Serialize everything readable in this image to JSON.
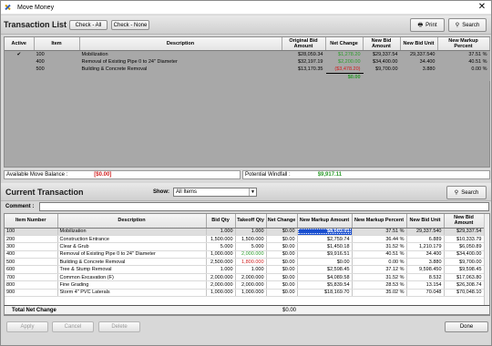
{
  "window": {
    "title": "Move Money"
  },
  "transaction_list": {
    "title": "Transaction List",
    "check_all_label": "Check - All",
    "check_none_label": "Check - None",
    "print_label": "Print",
    "search_label": "Search",
    "columns": [
      "Active",
      "Item",
      "Description",
      "Original Bid Amount",
      "Net Change",
      "New Bid Amount",
      "New Bid Unit",
      "New Markup Percent"
    ],
    "rows": [
      {
        "active": "✔",
        "item": "100",
        "description": "Mobilization",
        "original": "$28,059.34",
        "net": "$1,278.20",
        "net_color": "green",
        "new_amount": "$29,337.54",
        "new_unit": "29,337.540",
        "markup": "37.51 %"
      },
      {
        "active": "",
        "item": "400",
        "description": "Removal of Existing Pipe 0 to 24\" Diameter",
        "original": "$32,197.19",
        "net": "$2,200.00",
        "net_color": "green",
        "new_amount": "$34,400.00",
        "new_unit": "34.400",
        "markup": "40.51 %"
      },
      {
        "active": "",
        "item": "500",
        "description": "Building & Concrete Removal",
        "original": "$13,170.35",
        "net": "($3,478.20)",
        "net_color": "red",
        "new_amount": "$9,700.00",
        "new_unit": "3.880",
        "markup": "0.00 %"
      }
    ],
    "net_total": "$0.00",
    "available_label": "Available Move Balance :",
    "available_value": "[$0.00]",
    "windfall_label": "Potential Windfall :",
    "windfall_value": "$9,917.11"
  },
  "current_transaction": {
    "title": "Current Transaction",
    "show_label": "Show:",
    "show_value": "All Items",
    "search_label": "Search",
    "comment_label": "Comment :",
    "comment_value": "",
    "columns": [
      "Item Number",
      "Description",
      "Bid Qty",
      "Takeoff Qty",
      "Net Change",
      "New Markup Amount",
      "New Markup Percent",
      "New Bid Unit",
      "New Bid Amount"
    ],
    "rows": [
      {
        "item": "100",
        "description": "Mobilization",
        "bid_qty": "1.000",
        "takeoff_qty": "1.000",
        "takeoff_color": "",
        "net": "$0.00",
        "markup_amt": "$8,003.01",
        "markup_pct": "37.51 %",
        "bid_unit": "29,337.540",
        "bid_amt": "$29,337.54",
        "selected": true
      },
      {
        "item": "200",
        "description": "Construction Entrance",
        "bid_qty": "1,500.000",
        "takeoff_qty": "1,500.000",
        "takeoff_color": "",
        "net": "$0.00",
        "markup_amt": "$2,759.74",
        "markup_pct": "36.44 %",
        "bid_unit": "6.889",
        "bid_amt": "$10,333.79",
        "selected": false
      },
      {
        "item": "300",
        "description": "Clear & Grub",
        "bid_qty": "5.000",
        "takeoff_qty": "5.000",
        "takeoff_color": "",
        "net": "$0.00",
        "markup_amt": "$1,450.18",
        "markup_pct": "31.52 %",
        "bid_unit": "1,210.179",
        "bid_amt": "$6,050.89",
        "selected": false
      },
      {
        "item": "400",
        "description": "Removal of Existing Pipe 0 to 24\" Diameter",
        "bid_qty": "1,000.000",
        "takeoff_qty": "2,000.000",
        "takeoff_color": "green",
        "net": "$0.00",
        "markup_amt": "$9,916.51",
        "markup_pct": "40.51 %",
        "bid_unit": "34.400",
        "bid_amt": "$34,400.00",
        "selected": false
      },
      {
        "item": "500",
        "description": "Building & Concrete Removal",
        "bid_qty": "2,500.000",
        "takeoff_qty": "1,800.000",
        "takeoff_color": "red",
        "net": "$0.00",
        "markup_amt": "$0.00",
        "markup_pct": "0.00 %",
        "bid_unit": "3.880",
        "bid_amt": "$9,700.00",
        "selected": false
      },
      {
        "item": "600",
        "description": "Tree & Stump Removal",
        "bid_qty": "1.000",
        "takeoff_qty": "1.000",
        "takeoff_color": "",
        "net": "$0.00",
        "markup_amt": "$2,598.45",
        "markup_pct": "37.12 %",
        "bid_unit": "9,598.450",
        "bid_amt": "$9,598.45",
        "selected": false
      },
      {
        "item": "700",
        "description": "Common Excavation (F)",
        "bid_qty": "2,000.000",
        "takeoff_qty": "2,000.000",
        "takeoff_color": "",
        "net": "$0.00",
        "markup_amt": "$4,089.58",
        "markup_pct": "31.52 %",
        "bid_unit": "8.532",
        "bid_amt": "$17,063.80",
        "selected": false
      },
      {
        "item": "800",
        "description": "Fine Grading",
        "bid_qty": "2,000.000",
        "takeoff_qty": "2,000.000",
        "takeoff_color": "",
        "net": "$0.00",
        "markup_amt": "$5,839.54",
        "markup_pct": "28.53 %",
        "bid_unit": "13.154",
        "bid_amt": "$26,308.74",
        "selected": false
      },
      {
        "item": "900",
        "description": "Storm 4\" PVC Laterals",
        "bid_qty": "1,000.000",
        "takeoff_qty": "1,000.000",
        "takeoff_color": "",
        "net": "$0.00",
        "markup_amt": "$18,169.70",
        "markup_pct": "35.02 %",
        "bid_unit": "70.048",
        "bid_amt": "$70,048.10",
        "selected": false
      }
    ],
    "total_label": "Total Net Change",
    "total_value": "$0.00"
  },
  "footer": {
    "apply_label": "Apply",
    "cancel_label": "Cancel",
    "delete_label": "Delete",
    "done_label": "Done"
  },
  "colors": {
    "green": "#2b9b2b",
    "red": "#d02020",
    "selected_cell": "#1a4fd0",
    "top_grid_bg": "#a8a8a8"
  }
}
